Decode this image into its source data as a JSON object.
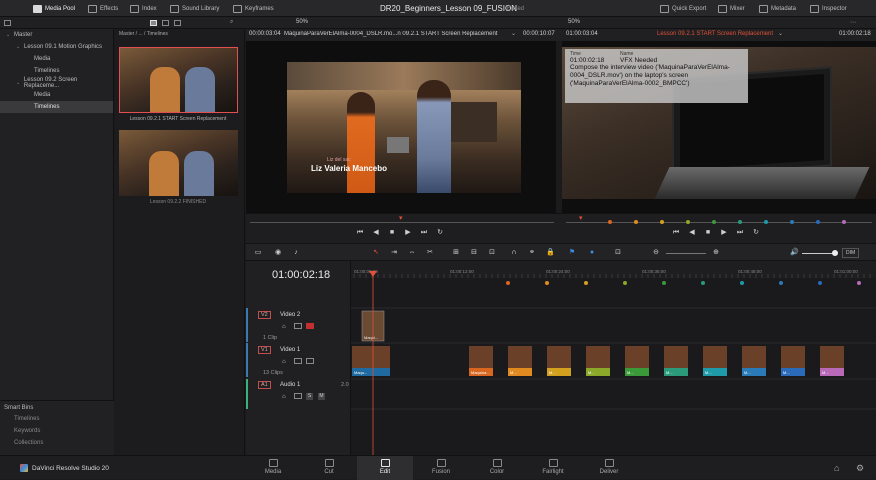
{
  "topbar": {
    "media_pool": "Media Pool",
    "effects": "Effects",
    "index": "Index",
    "sound_library": "Sound Library",
    "keyframes": "Keyframes",
    "project_title": "DR20_Beginners_Lesson 09_FUSION",
    "project_status": "Edited",
    "quick_export": "Quick Export",
    "mixer": "Mixer",
    "metadata": "Metadata",
    "inspector": "Inspector"
  },
  "subbar": {
    "zoom_left": "50%",
    "zoom_right": "50%"
  },
  "breadcrumb": "Master / ... / Timelines",
  "viewerbar": {
    "left_tc": "00:00:03:04",
    "left_clip": "MaquinaParaVerElAlma-0004_DSLR.mo...n 09.2.1 START Screen Replacement",
    "left_duration": "00:00:10:07",
    "right_tc": "01:00:03:04",
    "right_timeline": "Lesson 09.2.1 START Screen Replacement",
    "right_tc2": "01:00:02:18"
  },
  "bins": [
    {
      "label": "Master",
      "indent": 0,
      "selected": false
    },
    {
      "label": "Lesson 09.1 Motion Graphics",
      "indent": 1,
      "selected": false
    },
    {
      "label": "Media",
      "indent": 2,
      "selected": false
    },
    {
      "label": "Timelines",
      "indent": 2,
      "selected": false
    },
    {
      "label": "Lesson 09.2 Screen Replaceme...",
      "indent": 1,
      "selected": false
    },
    {
      "label": "Media",
      "indent": 2,
      "selected": false
    },
    {
      "label": "Timelines",
      "indent": 2,
      "selected": true
    }
  ],
  "smart_bins": {
    "title": "Smart Bins",
    "items": [
      "Timelines",
      "Keywords",
      "Collections"
    ]
  },
  "clips": [
    {
      "label": "Lesson 09.2.1 START Screen Replacement"
    },
    {
      "label": "Lesson 09.2.2 FINISHED"
    }
  ],
  "lower_third": {
    "line1": "Liz del sac",
    "line2": "Liz Valeria Mancebo"
  },
  "marker_note": {
    "col_time": "Time",
    "col_name": "Name",
    "time": "01:00:02:18",
    "name": "VFX Needed",
    "body": "Compose the interview video ('MaquinaParaVerElAlma-0004_DSLR.mov') on the laptop's screen ('MaquinaParaVerElAlma-0002_BMPCC')"
  },
  "timeline": {
    "timecode": "01:00:02:18",
    "ruler": [
      "01:00:00:00",
      "01:00:12:00",
      "01:00:24:00",
      "01:00:36:00",
      "01:00:48:00",
      "01:01:00:00"
    ],
    "tracks": [
      {
        "id": "V2",
        "name": "Video 2",
        "count": "1 Clip"
      },
      {
        "id": "V1",
        "name": "Video 1",
        "count": "13 Clips"
      },
      {
        "id": "A1",
        "name": "Audio 1",
        "level": "2.0"
      }
    ],
    "v2_clip": "Maqui...",
    "v1_clips": [
      {
        "label": "Maqu...",
        "color": "#1f6aa0"
      },
      {
        "label": "Maquina...",
        "color": "#d9661f"
      },
      {
        "label": "M...",
        "color": "#e08a1f"
      },
      {
        "label": "M...",
        "color": "#d4a11f"
      },
      {
        "label": "M...",
        "color": "#8ba82a"
      },
      {
        "label": "M...",
        "color": "#3a9a3a"
      },
      {
        "label": "M...",
        "color": "#2a9a7a"
      },
      {
        "label": "M...",
        "color": "#1f9aa8"
      },
      {
        "label": "M...",
        "color": "#2a7ab8"
      },
      {
        "label": "M...",
        "color": "#2a6ab8"
      },
      {
        "label": "M...",
        "color": "#b86ab8"
      }
    ],
    "dim_label": "DIM"
  },
  "pages": [
    {
      "label": "Media",
      "active": false
    },
    {
      "label": "Cut",
      "active": false
    },
    {
      "label": "Edit",
      "active": true
    },
    {
      "label": "Fusion",
      "active": false
    },
    {
      "label": "Color",
      "active": false
    },
    {
      "label": "Fairlight",
      "active": false
    },
    {
      "label": "Deliver",
      "active": false
    }
  ],
  "app_name": "DaVinci Resolve Studio 20"
}
